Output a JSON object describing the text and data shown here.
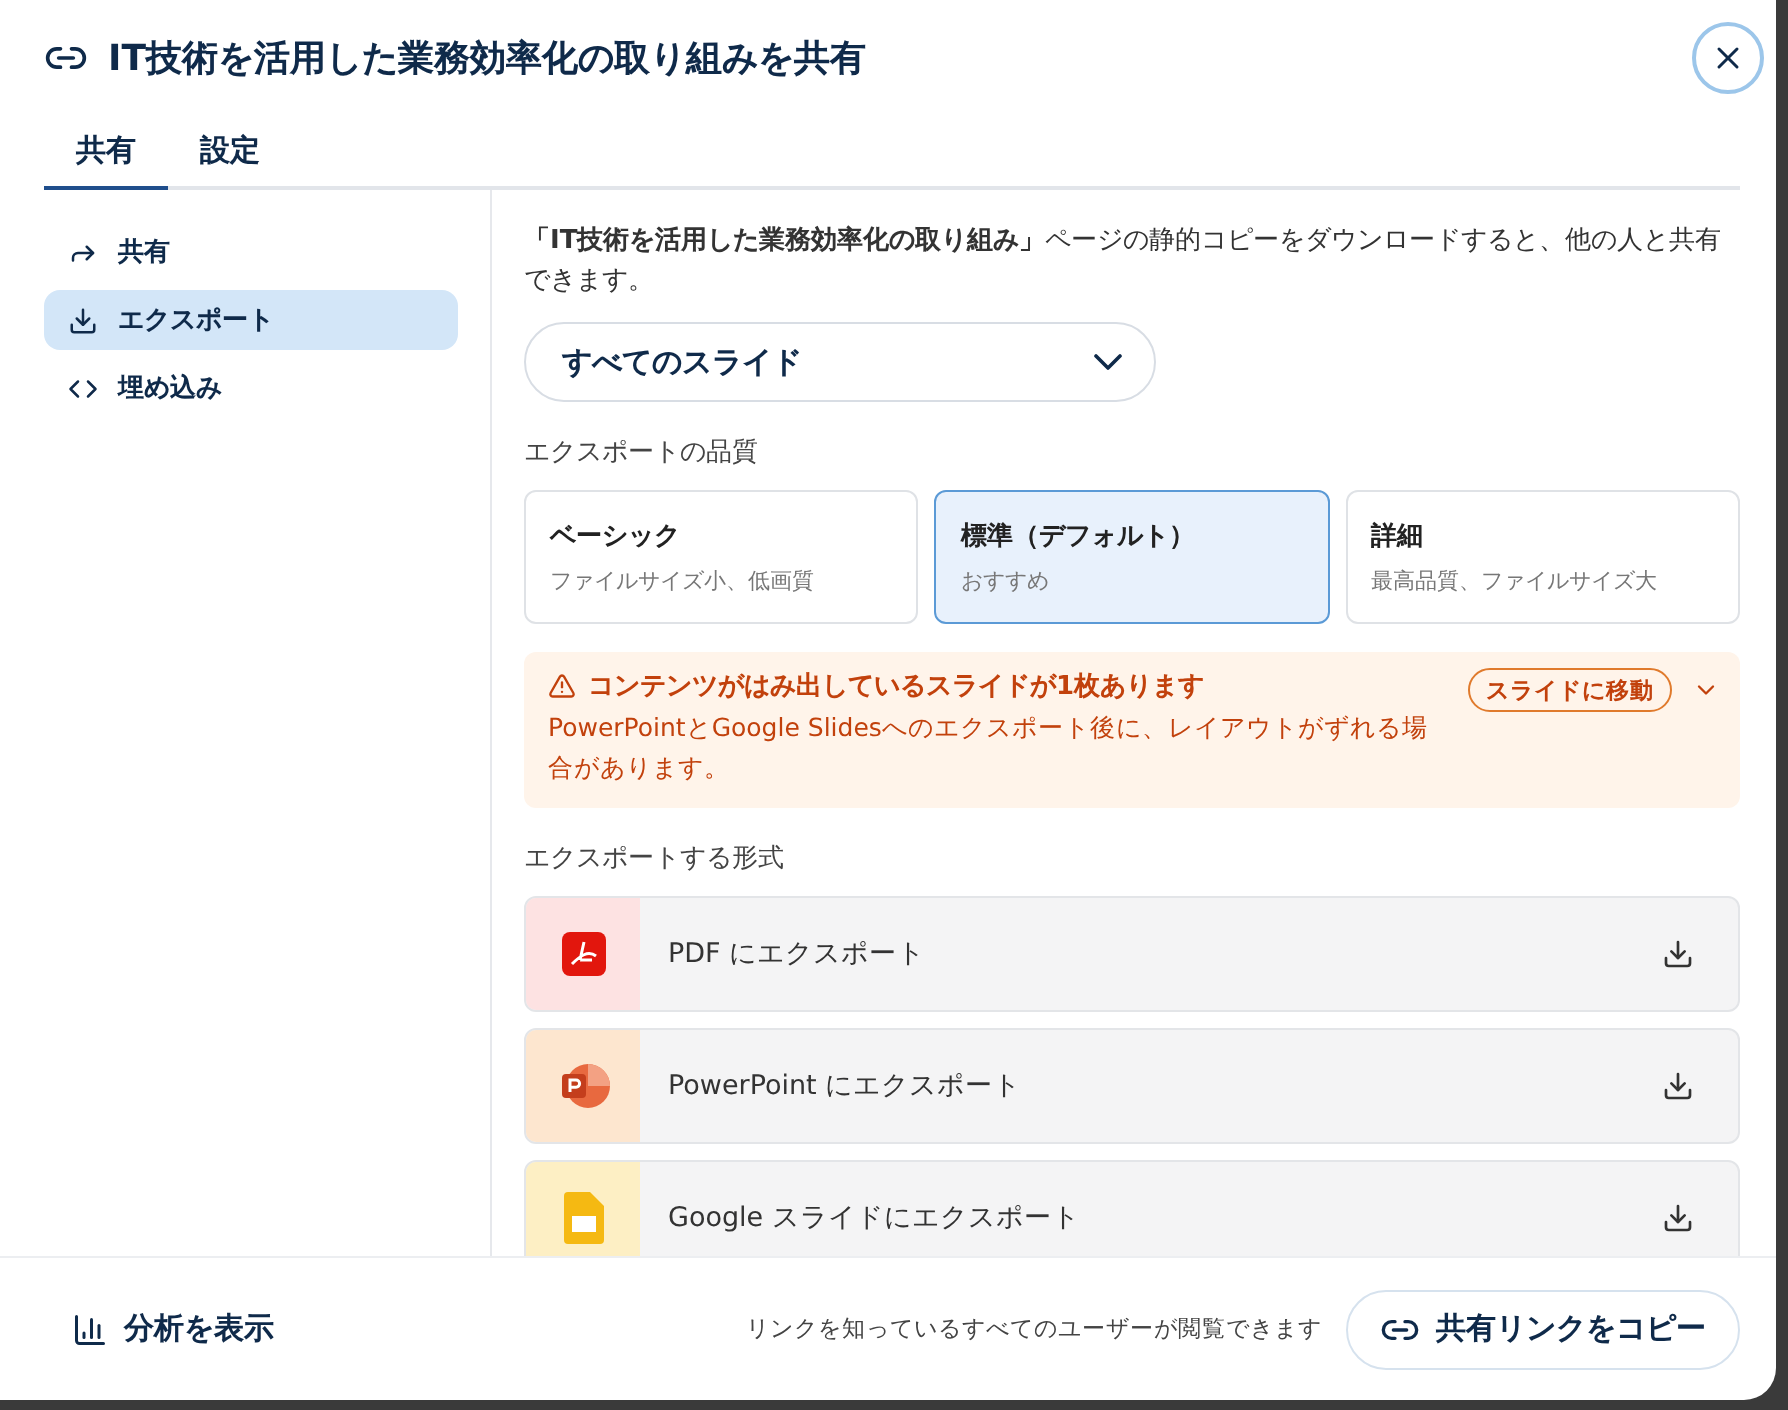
{
  "title": "IT技術を活用した業務効率化の取り組みを共有",
  "tabs": [
    {
      "label": "共有",
      "selected": true
    },
    {
      "label": "設定",
      "selected": false
    }
  ],
  "sidebar": {
    "items": [
      {
        "kind": "share",
        "label": "共有",
        "selected": false
      },
      {
        "kind": "export",
        "label": "エクスポート",
        "selected": true
      },
      {
        "kind": "embed",
        "label": "埋め込み",
        "selected": false
      }
    ]
  },
  "description": "**「IT技術を活用した業務効率化の取り組み」**ページの静的コピーをダウンロードすると、他の人と共有できます。",
  "scope_select": {
    "value": "すべてのスライド"
  },
  "quality": {
    "label": "エクスポートの品質",
    "options": [
      {
        "title": "ベーシック",
        "subtitle": "ファイルサイズ小、低画質",
        "selected": false
      },
      {
        "title": "標準（デフォルト）",
        "subtitle": "おすすめ",
        "selected": true
      },
      {
        "title": "詳細",
        "subtitle": "最高品質、ファイルサイズ大",
        "selected": false
      }
    ]
  },
  "warning": {
    "title": "コンテンツがはみ出しているスライドが1枚あります",
    "message": "PowerPointとGoogle Slidesへのエクスポート後に、レイアウトがずれる場合があります。",
    "action": "スライドに移動"
  },
  "formats": {
    "label": "エクスポートする形式",
    "items": [
      {
        "kind": "pdf",
        "label": "PDF にエクスポート"
      },
      {
        "kind": "powerpoint",
        "label": "PowerPoint にエクスポート"
      },
      {
        "kind": "google_slides",
        "label": "Google スライドにエクスポート"
      }
    ]
  },
  "footer": {
    "analytics": "分析を表示",
    "note": "リンクを知っているすべてのユーザーが閲覧できます",
    "copy_button": "共有リンクをコピー"
  }
}
